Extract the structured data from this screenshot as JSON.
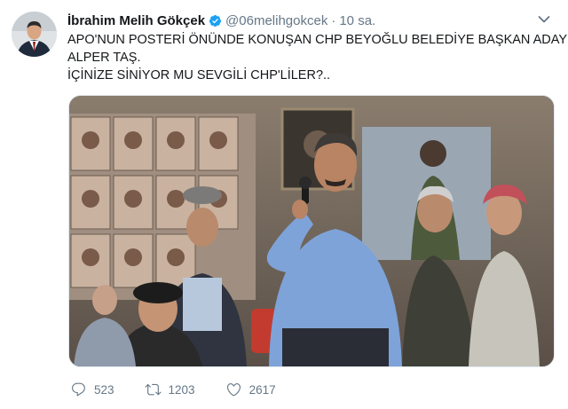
{
  "tweet": {
    "author_name": "İbrahim Melih Gökçek",
    "handle": "@06melihgokcek",
    "separator": "·",
    "time": "10 sa.",
    "text_lines": [
      "APO'NUN POSTERİ ÖNÜNDE KONUŞAN CHP BEYOĞLU BELEDİYE BAŞKAN ADAYI",
      "ALPER TAŞ.",
      "İÇİNİZE SİNİYOR MU SEVGİLİ CHP'LİLER?.."
    ],
    "actions": {
      "replies": "523",
      "retweets": "1203",
      "likes": "2617"
    }
  },
  "icons": {
    "verified": "verified-badge-icon",
    "caret": "chevron-down-icon",
    "reply": "reply-icon",
    "retweet": "retweet-icon",
    "like": "heart-icon"
  },
  "colors": {
    "verified": "#1da1f2",
    "secondary_text": "#657786",
    "primary_text": "#14171a"
  }
}
